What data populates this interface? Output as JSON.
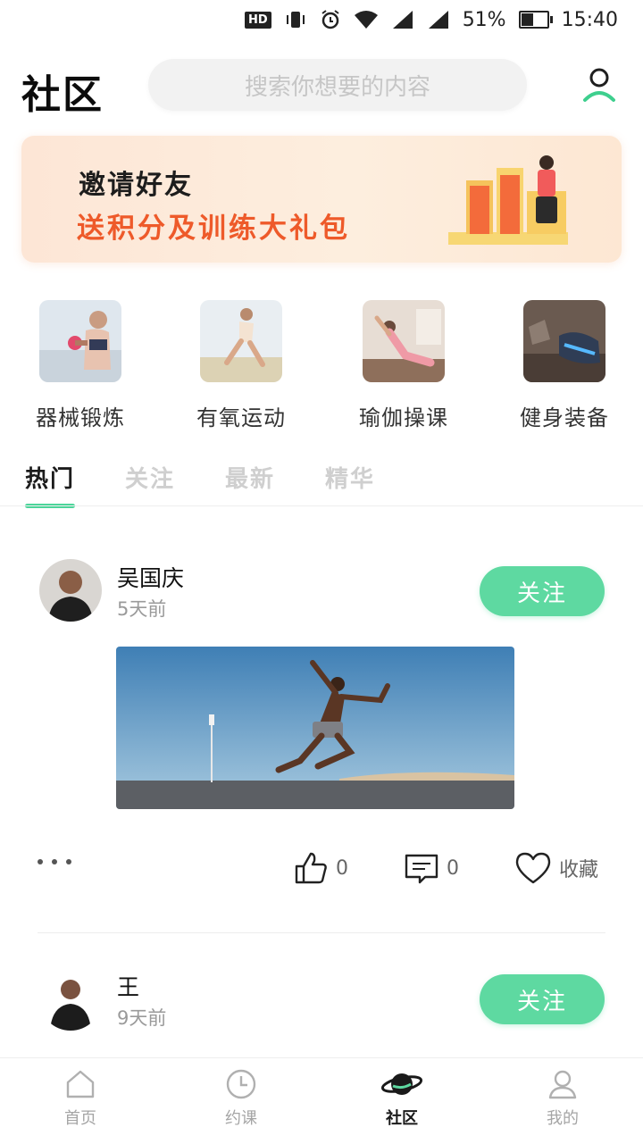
{
  "status_bar": {
    "hd": "HD",
    "battery": "51%",
    "time": "15:40",
    "battery_level": 0.51
  },
  "header": {
    "title": "社区",
    "search_placeholder": "搜索你想要的内容"
  },
  "banner": {
    "line1": "邀请好友",
    "line2": "送积分及训练大礼包"
  },
  "categories": [
    {
      "label": "器械锻炼"
    },
    {
      "label": "有氧运动"
    },
    {
      "label": "瑜伽操课"
    },
    {
      "label": "健身装备"
    }
  ],
  "tabs": [
    {
      "label": "热门",
      "active": true
    },
    {
      "label": "关注"
    },
    {
      "label": "最新"
    },
    {
      "label": "精华"
    }
  ],
  "posts": [
    {
      "author": "吴国庆",
      "time": "5天前",
      "follow": "关注",
      "likes": "0",
      "comments": "0",
      "favorite": "收藏"
    },
    {
      "author": "王",
      "time": "9天前",
      "follow": "关注"
    }
  ],
  "bottom_nav": [
    {
      "label": "首页",
      "icon": "home-icon"
    },
    {
      "label": "约课",
      "icon": "clock-icon"
    },
    {
      "label": "社区",
      "icon": "planet-icon",
      "active": true
    },
    {
      "label": "我的",
      "icon": "profile-icon"
    }
  ],
  "colors": {
    "accent": "#5ed9a1",
    "tab_indicator": "#4cd59a",
    "banner_orange": "#ee5a2a"
  }
}
